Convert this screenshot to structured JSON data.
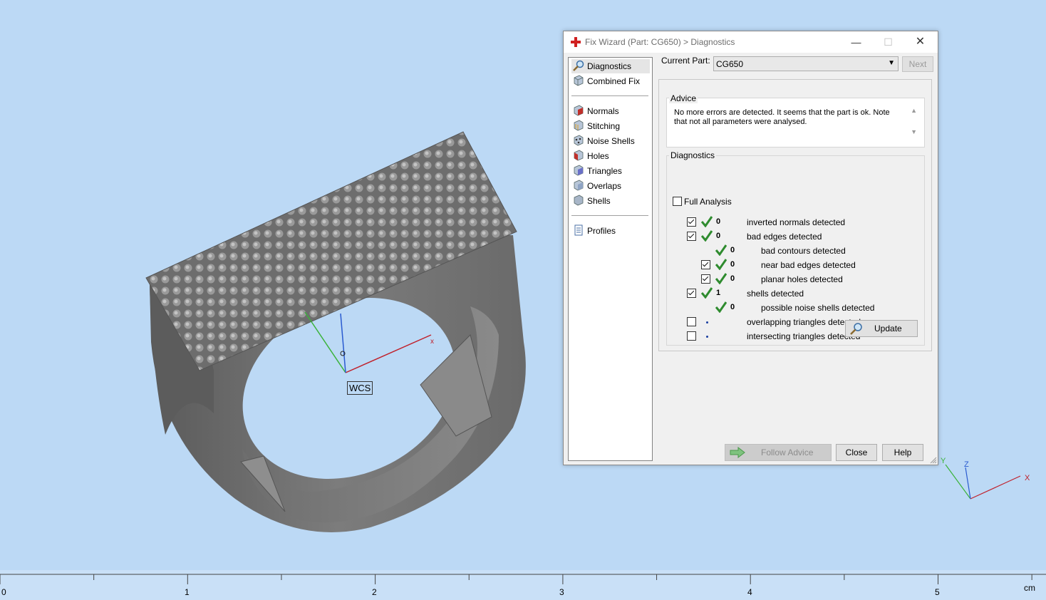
{
  "viewport": {
    "wcs_label": "WCS",
    "triad": {
      "x": "X",
      "y": "Y",
      "z": "Z"
    },
    "ruler": {
      "ticks": [
        "0",
        "1",
        "2",
        "3",
        "4",
        "5"
      ],
      "unit": "cm"
    }
  },
  "dialog": {
    "title": "Fix Wizard (Part: CG650) > Diagnostics",
    "icons": {
      "title": "red-cross-icon",
      "minimize": "minimize-icon",
      "maximize": "maximize-icon",
      "close": "close-icon"
    },
    "sidebar": {
      "top_items": [
        {
          "label": "Diagnostics",
          "icon": "magnifier-icon"
        },
        {
          "label": "Combined Fix",
          "icon": "combined-fix-icon"
        }
      ],
      "fix_items": [
        {
          "label": "Normals",
          "icon": "normals-icon"
        },
        {
          "label": "Stitching",
          "icon": "stitching-icon"
        },
        {
          "label": "Noise Shells",
          "icon": "noise-shells-icon"
        },
        {
          "label": "Holes",
          "icon": "holes-icon"
        },
        {
          "label": "Triangles",
          "icon": "triangles-icon"
        },
        {
          "label": "Overlaps",
          "icon": "overlaps-icon"
        },
        {
          "label": "Shells",
          "icon": "shells-icon"
        }
      ],
      "bottom_items": [
        {
          "label": "Profiles",
          "icon": "profiles-icon"
        }
      ]
    },
    "current_part": {
      "label": "Current Part:",
      "value": "CG650"
    },
    "next_label": "Next",
    "advice": {
      "title": "Advice",
      "text": "No more errors are detected. It seems that the part is ok. Note that not all parameters were analysed."
    },
    "diagnostics": {
      "title": "Diagnostics",
      "full_analysis": {
        "label": "Full Analysis",
        "checked": false
      },
      "rows": [
        {
          "checkbox": true,
          "checked": true,
          "status": "ok",
          "count": "0",
          "label": "inverted normals detected",
          "indent": 0
        },
        {
          "checkbox": true,
          "checked": true,
          "status": "ok",
          "count": "0",
          "label": "bad edges detected",
          "indent": 0
        },
        {
          "checkbox": false,
          "checked": false,
          "status": "ok",
          "count": "0",
          "label": "bad contours detected",
          "indent": 1
        },
        {
          "checkbox": true,
          "checked": true,
          "status": "ok",
          "count": "0",
          "label": "near bad edges detected",
          "indent": 1
        },
        {
          "checkbox": true,
          "checked": true,
          "status": "ok",
          "count": "0",
          "label": "planar holes detected",
          "indent": 1
        },
        {
          "checkbox": true,
          "checked": true,
          "status": "ok",
          "count": "1",
          "label": "shells detected",
          "indent": 0
        },
        {
          "checkbox": false,
          "checked": false,
          "status": "ok",
          "count": "0",
          "label": "possible noise shells detected",
          "indent": 1
        },
        {
          "checkbox": true,
          "checked": false,
          "status": "pending",
          "count": "",
          "label": "overlapping triangles detected",
          "indent": 0
        },
        {
          "checkbox": true,
          "checked": false,
          "status": "pending",
          "count": "",
          "label": "intersecting triangles detected",
          "indent": 0
        }
      ],
      "update_label": "Update"
    },
    "buttons": {
      "follow_advice": "Follow Advice",
      "close": "Close",
      "help": "Help"
    },
    "colors": {
      "ok_tick": "#2e8b2e",
      "pending_dot": "#1a3fa0",
      "axis_x": "#c0202a",
      "axis_y": "#3bb33b",
      "axis_z": "#2a5bd0"
    }
  }
}
